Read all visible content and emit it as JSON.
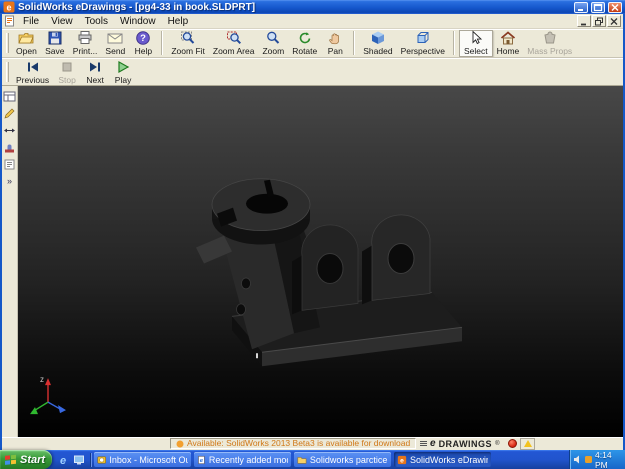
{
  "titlebar": {
    "title": "SolidWorks eDrawings - [pg4-33 in book.SLDPRT]"
  },
  "menubar": {
    "items": [
      "File",
      "View",
      "Tools",
      "Window",
      "Help"
    ]
  },
  "toolbar": {
    "buttons": [
      "Open",
      "Save",
      "Print...",
      "Send",
      "Help",
      "Zoom Fit",
      "Zoom Area",
      "Zoom",
      "Rotate",
      "Pan",
      "Shaded",
      "Perspective",
      "Select",
      "Home",
      "Mass Props"
    ]
  },
  "animbar": {
    "buttons": [
      "Previous",
      "Stop",
      "Next",
      "Play"
    ]
  },
  "sidebar": {
    "overflow": "»"
  },
  "viewport": {
    "triad_axis_label": "z"
  },
  "status": {
    "notice": "Available: SolidWorks 2013 Beta3 is available for download",
    "brand_e": "e",
    "brand": "DRAWINGS",
    "registered": "®"
  },
  "taskbar": {
    "start_label": "Start",
    "tasks": [
      "Inbox - Microsoft Outlook",
      "Recently added models -...",
      "Solidworks parctice test",
      "SolidWorks eDrawing..."
    ],
    "clock": "4:14 PM"
  },
  "colors": {
    "titlebar_blue": "#1557cc",
    "toolbar_bg": "#ece9d8",
    "viewport_top": "#484848",
    "viewport_bottom": "#000000",
    "model_gray": "#242424",
    "notice_orange": "#d07818",
    "taskbar_blue": "#2154cd",
    "start_green": "#379a37",
    "active_task_blue": "#1c49ad"
  }
}
